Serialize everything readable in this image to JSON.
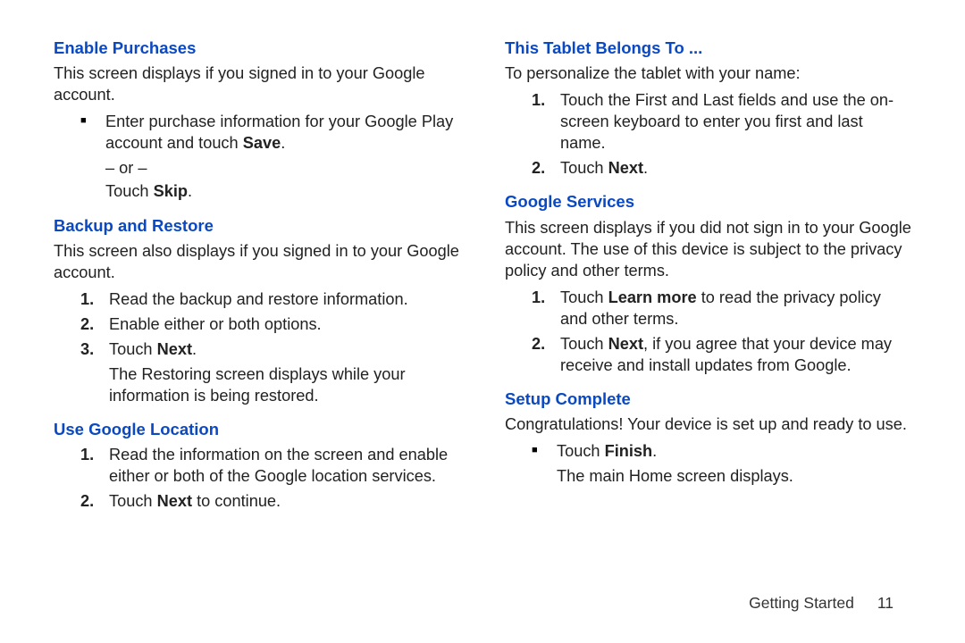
{
  "left": {
    "s1": {
      "heading": "Enable Purchases",
      "intro": "This screen displays if you signed in to your Google account.",
      "bullet_pre": "Enter purchase information for your Google Play account and touch ",
      "bullet_bold": "Save",
      "bullet_post": ".",
      "or": "– or –",
      "skip_pre": "Touch ",
      "skip_bold": "Skip",
      "skip_post": "."
    },
    "s2": {
      "heading": "Backup and Restore",
      "intro": "This screen also displays if you signed in to your Google account.",
      "n1": "Read the backup and restore information.",
      "n2": "Enable either or both options.",
      "n3_pre": "Touch ",
      "n3_bold": "Next",
      "n3_post": ".",
      "n3_sub": "The Restoring screen displays while your information is being restored."
    },
    "s3": {
      "heading": "Use Google Location",
      "n1": "Read the information on the screen and enable either or both of the Google location services.",
      "n2_pre": "Touch ",
      "n2_bold": "Next",
      "n2_post": " to continue."
    }
  },
  "right": {
    "s1": {
      "heading": "This Tablet Belongs To ...",
      "intro": "To personalize the tablet with your name:",
      "n1": "Touch the First and Last fields and use the on-screen keyboard to enter you first and last name.",
      "n2_pre": "Touch ",
      "n2_bold": "Next",
      "n2_post": "."
    },
    "s2": {
      "heading": "Google Services",
      "intro": "This screen displays if you did not sign in to your Google account. The use of this device is subject to the privacy policy and other terms.",
      "n1_pre": "Touch ",
      "n1_bold": "Learn more",
      "n1_post": " to read the privacy policy and other terms.",
      "n2_pre": "Touch ",
      "n2_bold": "Next",
      "n2_post": ", if you agree that your device may receive and install updates from Google."
    },
    "s3": {
      "heading": "Setup Complete",
      "intro": "Congratulations! Your device is set up and ready to use.",
      "bullet_pre": "Touch ",
      "bullet_bold": "Finish",
      "bullet_post": ".",
      "bullet_sub": "The main Home screen displays."
    }
  },
  "footer": {
    "section": "Getting Started",
    "page": "11"
  }
}
